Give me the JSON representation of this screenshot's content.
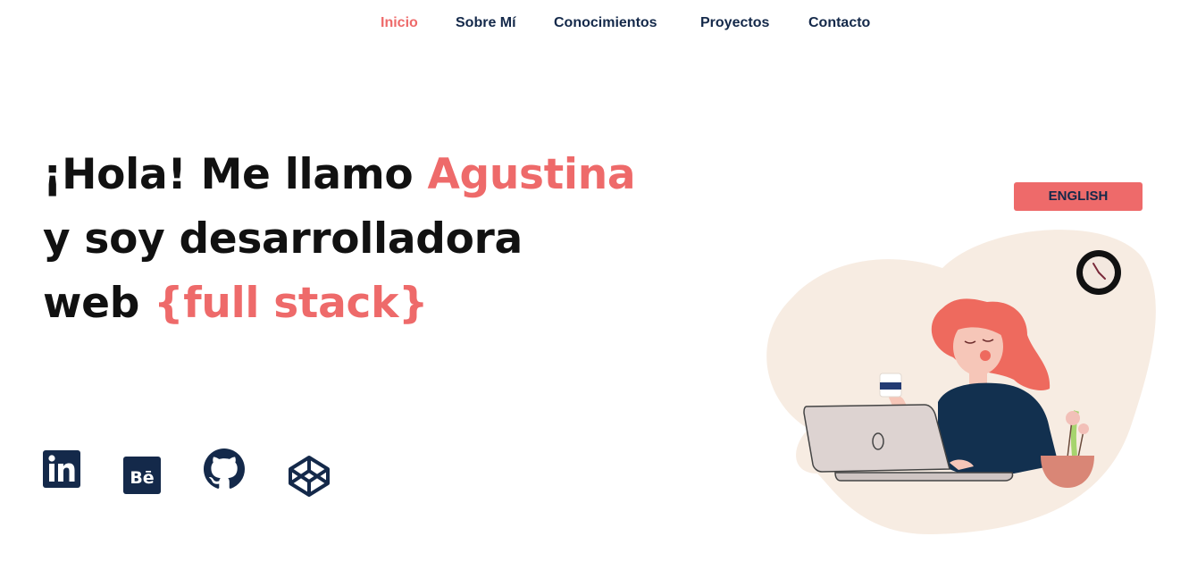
{
  "nav": {
    "items": [
      {
        "label": "Inicio",
        "active": true
      },
      {
        "label": "Sobre Mí",
        "active": false
      },
      {
        "label": "Conocimientos",
        "active": false
      },
      {
        "label": "Proyectos",
        "active": false
      },
      {
        "label": "Contacto",
        "active": false
      }
    ]
  },
  "hero": {
    "line1_prefix": "¡Hola! Me llamo ",
    "line1_name": "Agustina",
    "line2": "y soy desarrolladora",
    "line3_prefix": "web ",
    "line3_accent": "{full stack}"
  },
  "social": {
    "icons": [
      "linkedin-icon",
      "behance-icon",
      "github-icon",
      "codepen-icon"
    ],
    "behance_glyph": "Bē",
    "linkedin_glyph": "in"
  },
  "language_button": {
    "label": "ENGLISH"
  },
  "colors": {
    "accent": "#ee6a6a",
    "navy": "#14294a",
    "blob": "#f7ece2",
    "text": "#111111"
  }
}
